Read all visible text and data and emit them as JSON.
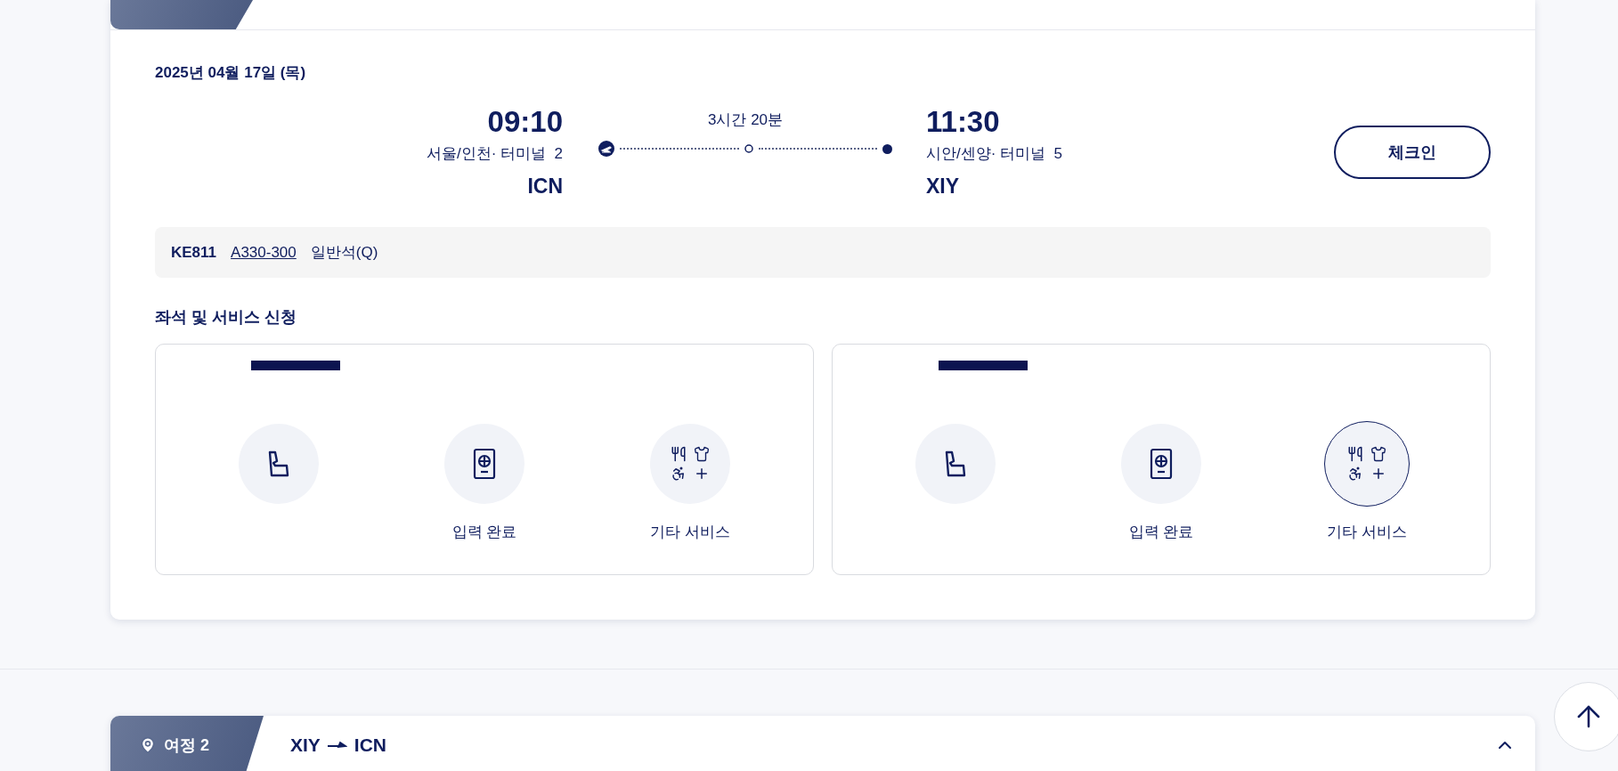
{
  "journey_1": {
    "date": "2025년 04월 17일 (목)",
    "departure": {
      "time": "09:10",
      "place": "서울/인천· 터미널  2",
      "code": "ICN"
    },
    "duration": "3시간 20분",
    "arrival": {
      "time": "11:30",
      "place": "시안/센양· 터미널  5",
      "code": "XIY"
    },
    "checkin_button": "체크인",
    "flight": {
      "number": "KE811",
      "aircraft": "A330-300",
      "cabin": "일반석(Q)"
    },
    "services_title": "좌석 및 서비스 신청",
    "passengers": [
      {
        "services": [
          {
            "kind": "seat",
            "selected": false
          },
          {
            "kind": "passport",
            "label": "입력 완료",
            "selected": false
          },
          {
            "kind": "other",
            "label": "기타 서비스",
            "selected": false
          }
        ]
      },
      {
        "services": [
          {
            "kind": "seat",
            "selected": false
          },
          {
            "kind": "passport",
            "label": "입력 완료",
            "selected": false
          },
          {
            "kind": "other",
            "label": "기타 서비스",
            "selected": true
          }
        ]
      }
    ]
  },
  "journey_2": {
    "label": "여정 2",
    "origin": "XIY",
    "destination": "ICN"
  }
}
